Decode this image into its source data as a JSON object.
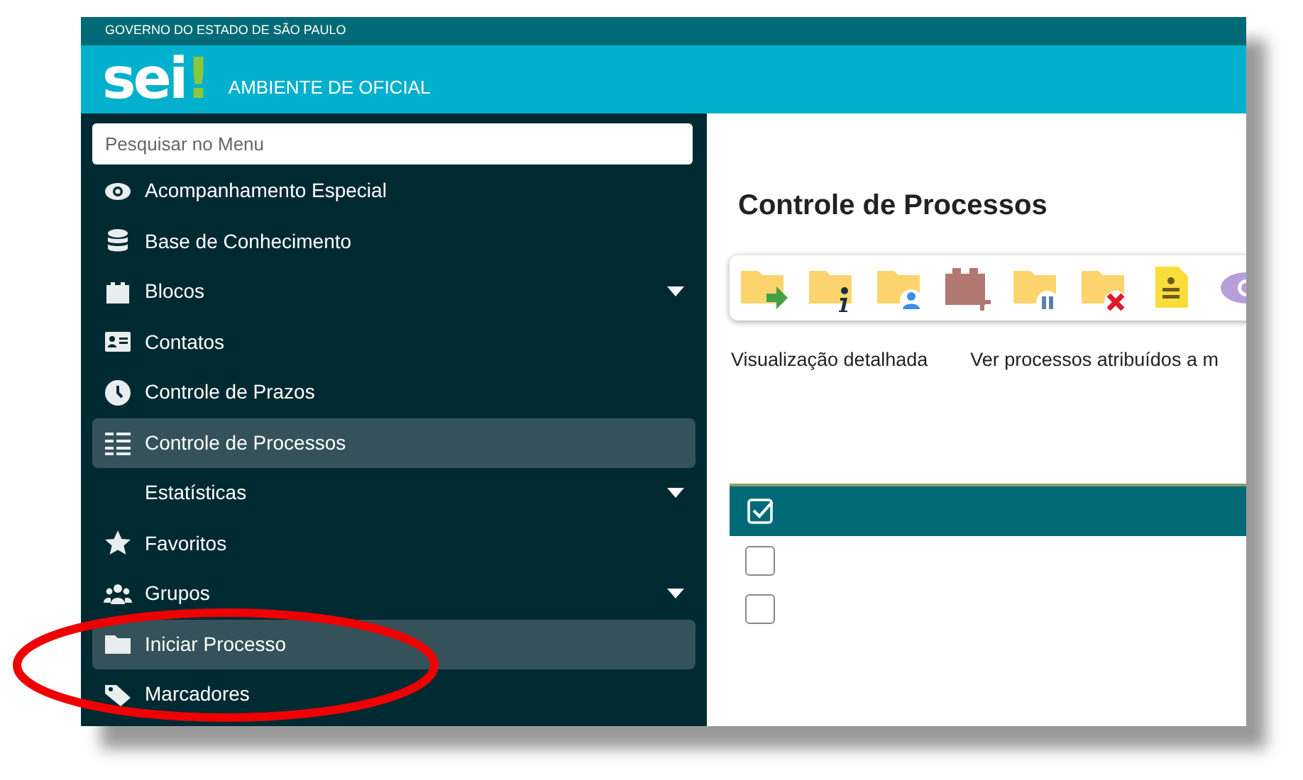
{
  "top_bar": {
    "text": "GOVERNO DO ESTADO DE SÃO PAULO"
  },
  "header": {
    "logo": "sei",
    "logo_mark": "!",
    "environment": "AMBIENTE DE OFICIAL"
  },
  "sidebar": {
    "search": {
      "placeholder": "Pesquisar no Menu"
    },
    "items": [
      {
        "label": "Acompanhamento Especial",
        "selected": false,
        "submenu": false
      },
      {
        "label": "Base de Conhecimento",
        "selected": false,
        "submenu": false
      },
      {
        "label": "Blocos",
        "selected": false,
        "submenu": true
      },
      {
        "label": "Contatos",
        "selected": false,
        "submenu": false
      },
      {
        "label": "Controle de Prazos",
        "selected": false,
        "submenu": false
      },
      {
        "label": "Controle de Processos",
        "selected": true,
        "submenu": false
      },
      {
        "label": "Estatísticas",
        "selected": false,
        "submenu": true
      },
      {
        "label": "Favoritos",
        "selected": false,
        "submenu": false
      },
      {
        "label": "Grupos",
        "selected": false,
        "submenu": true
      },
      {
        "label": "Iniciar Processo",
        "selected": true,
        "submenu": false
      },
      {
        "label": "Marcadores",
        "selected": false,
        "submenu": false
      }
    ]
  },
  "main": {
    "title": "Controle de Processos",
    "links": [
      "Visualização detalhada",
      "Ver processos atribuídos a m"
    ],
    "table": {
      "header_checked": true,
      "rows": [
        {
          "checked": false
        },
        {
          "checked": false
        }
      ]
    }
  }
}
